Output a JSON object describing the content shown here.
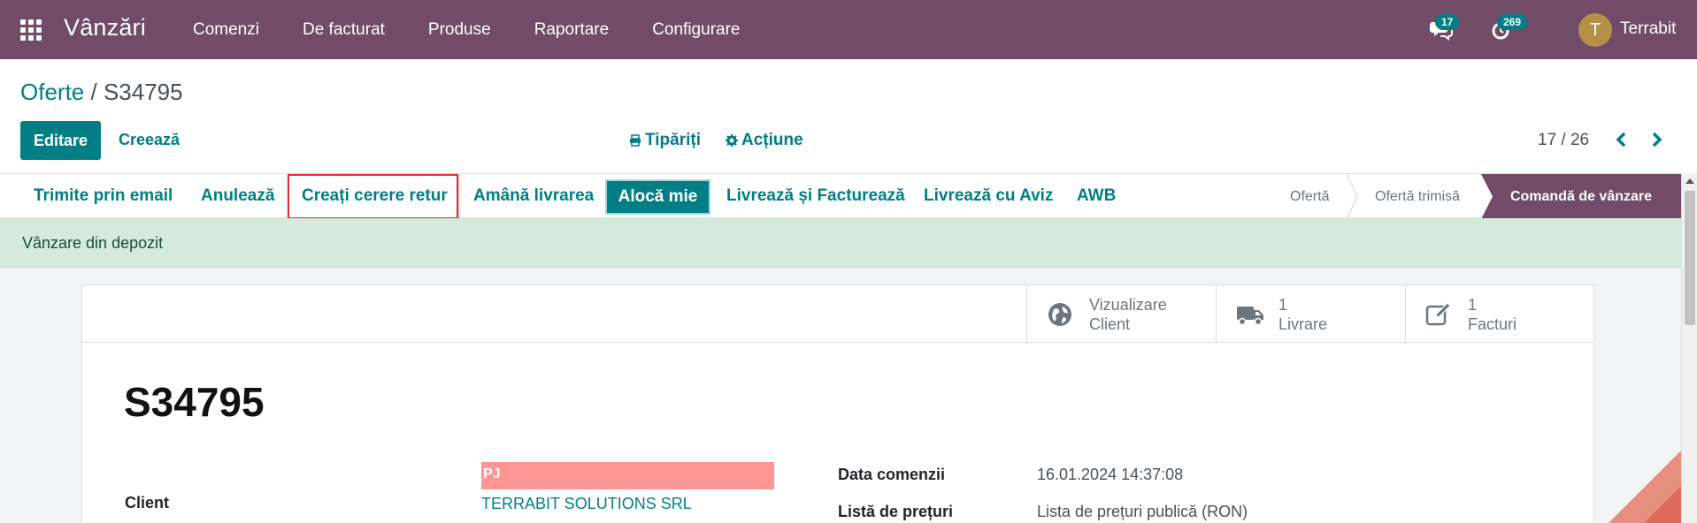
{
  "navbar": {
    "app_name": "Vânzări",
    "menu": [
      "Comenzi",
      "De facturat",
      "Produse",
      "Raportare",
      "Configurare"
    ],
    "messages_count": "17",
    "activities_count": "269",
    "user_initial": "T",
    "user_name": "Terrabit",
    "color": "#714b67"
  },
  "control": {
    "breadcrumb_parent": "Oferte",
    "breadcrumb_separator": "/",
    "breadcrumb_current": "S34795",
    "edit_label": "Editare",
    "create_label": "Creează",
    "print_label": "Tipăriți",
    "action_label": "Acțiune",
    "pager": "17 / 26"
  },
  "statusbar": {
    "buttons": [
      "Trimite prin email",
      "Anulează",
      "Creați cerere retur",
      "Amână livrarea",
      "Alocă mie",
      "Livrează și Facturează",
      "Livrează cu Aviz",
      "AWB"
    ],
    "stages": [
      "Ofertă",
      "Ofertă trimisă",
      "Comandă de vânzare"
    ],
    "active_stage": "Comandă de vânzare"
  },
  "alert": {
    "text": "Vânzare din depozit"
  },
  "smart_buttons": [
    {
      "icon": "globe-icon",
      "line1": "Vizualizare",
      "line2": "Client"
    },
    {
      "icon": "truck-icon",
      "line1": "1",
      "line2": "Livrare"
    },
    {
      "icon": "edit-icon",
      "line1": "1",
      "line2": "Facturi"
    }
  ],
  "form": {
    "title": "S34795",
    "client_label": "Client",
    "client_tag": "PJ",
    "client_name": "TERRABIT SOLUTIONS SRL",
    "order_date_label": "Data comenzii",
    "order_date": "16.01.2024 14:37:08",
    "pricelist_label": "Listă de prețuri",
    "pricelist": "Lista de prețuri publică (RON)"
  },
  "colors": {
    "primary": "#017e84",
    "brand": "#714b67",
    "alert_bg": "#d4eadd",
    "tag": "#ff9696"
  }
}
